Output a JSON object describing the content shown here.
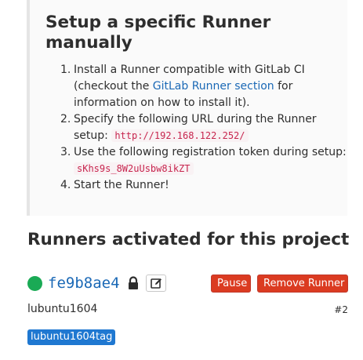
{
  "setup": {
    "title": "Setup a specific Runner manually",
    "steps": [
      {
        "number": "1.",
        "text_before": "Install a Runner compatible with GitLab CI (checkout the ",
        "link_text": "GitLab Runner section",
        "text_after": " for information on how to install it)."
      },
      {
        "number": "2.",
        "text": "Specify the following URL during the Runner setup: ",
        "code": "http://192.168.122.252/"
      },
      {
        "number": "3.",
        "text": "Use the following registration token during setup: ",
        "code": "sKhs9s_8W2uUsbw8ikZT"
      },
      {
        "number": "4.",
        "text": "Start the Runner!"
      }
    ]
  },
  "runners": {
    "title": "Runners activated for this project",
    "items": [
      {
        "status_color": "#1aaa55",
        "token": "fe9b8ae4",
        "lock_icon": "lock-icon",
        "edit_icon": "edit-icon",
        "pause_label": "Pause",
        "remove_label": "Remove Runner",
        "description": "lubuntu1604",
        "id_label": "#2",
        "tags": [
          "lubuntu1604tag"
        ]
      }
    ]
  },
  "colors": {
    "link": "#1b69b6",
    "danger": "#db3b21",
    "tag": "#1f78d1",
    "code_text": "#c7254e",
    "code_bg": "#f9f2f4"
  }
}
